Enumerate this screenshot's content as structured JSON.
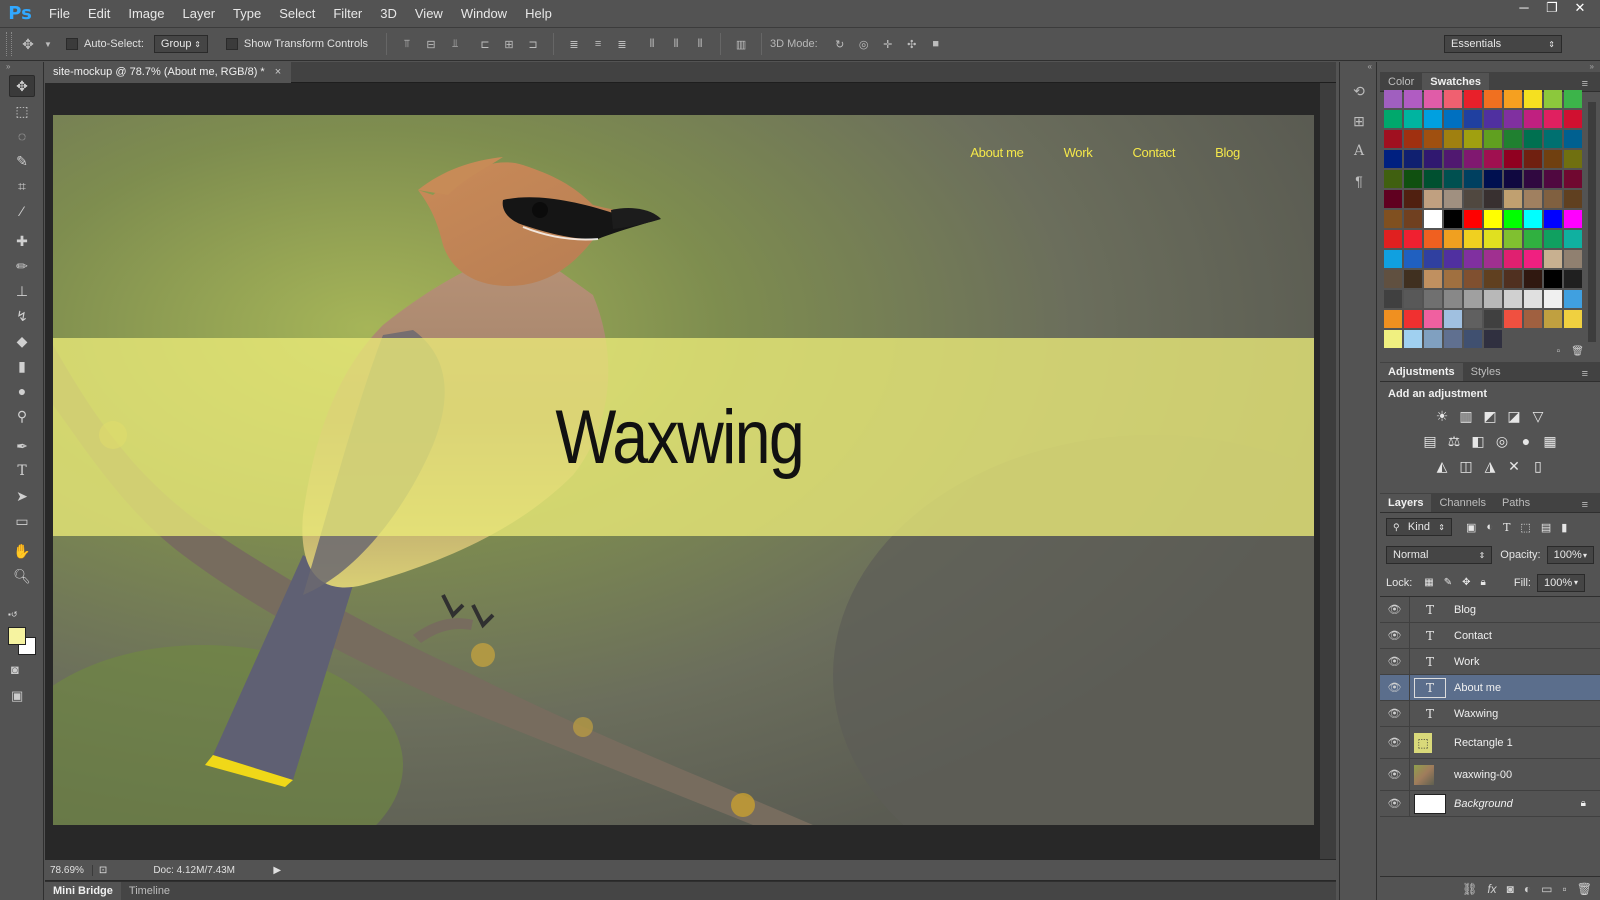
{
  "app": {
    "logo": "Ps",
    "menu": [
      "File",
      "Edit",
      "Image",
      "Layer",
      "Type",
      "Select",
      "Filter",
      "3D",
      "View",
      "Window",
      "Help"
    ]
  },
  "window_controls": [
    "─",
    "❐",
    "✕"
  ],
  "options_bar": {
    "auto_select_label": "Auto-Select:",
    "auto_select_value": "Group",
    "show_transform_label": "Show Transform Controls",
    "mode_label": "3D Mode:",
    "workspace": "Essentials"
  },
  "document": {
    "tab_title": "site-mockup @ 78.7% (About me, RGB/8) *",
    "close_glyph": "×",
    "zoom": "78.69%",
    "doc_info": "Doc: 4.12M/7.43M"
  },
  "canvas": {
    "nav": [
      "About me",
      "Work",
      "Contact",
      "Blog"
    ],
    "title": "Waxwing",
    "nav_color": "#f5e84a",
    "band_color": "#ebeb78"
  },
  "bottom_tabs": [
    "Mini Bridge",
    "Timeline"
  ],
  "swatches_panel": {
    "tabs": [
      "Color",
      "Swatches"
    ],
    "active": "Swatches",
    "colors": [
      "#a05fbf",
      "#b05cc2",
      "#e05ca8",
      "#f06070",
      "#e8202a",
      "#f07020",
      "#f5a020",
      "#f5e020",
      "#8cc83c",
      "#3cb44a",
      "#00a86c",
      "#00b4a0",
      "#00a0e0",
      "#0070c0",
      "#2040a0",
      "#5030a0",
      "#8030a0",
      "#c02080",
      "#e02060",
      "#d01030",
      "#a01020",
      "#a03010",
      "#a05010",
      "#a08010",
      "#a0a010",
      "#60a020",
      "#208030",
      "#007050",
      "#007070",
      "#006090",
      "#002080",
      "#102070",
      "#301870",
      "#501870",
      "#801870",
      "#a01050",
      "#900020",
      "#702010",
      "#704010",
      "#707010",
      "#406010",
      "#105010",
      "#005030",
      "#005050",
      "#004060",
      "#001050",
      "#100840",
      "#300840",
      "#500840",
      "#700830",
      "#600020",
      "#502010",
      "#c0a080",
      "#a09080",
      "#504840",
      "#383030",
      "#c0a070",
      "#a08060",
      "#806040",
      "#604020",
      "#805020",
      "#704020",
      "#ffffff",
      "#000000",
      "#ff0000",
      "#ffff00",
      "#00ff00",
      "#00ffff",
      "#0000ff",
      "#ff00ff",
      "#e02020",
      "#f02030",
      "#f06020",
      "#f0a020",
      "#f0d020",
      "#e0e020",
      "#80c030",
      "#30b040",
      "#10a060",
      "#10b0a0",
      "#10a0e0",
      "#2060c0",
      "#3040a0",
      "#5030a0",
      "#8030a0",
      "#a03090",
      "#e02070",
      "#f02080",
      "#c8b090",
      "#908070",
      "#605040",
      "#403020",
      "#c09060",
      "#a07040",
      "#805030",
      "#604020",
      "#503020",
      "#301810",
      "#000000",
      "#202020",
      "#404040",
      "#585858",
      "#707070",
      "#888888",
      "#a0a0a0",
      "#b8b8b8",
      "#d0d0d0",
      "#e0e0e0",
      "#f0f0f0",
      "#40a0e0",
      "#f09020",
      "#f03030",
      "#f060a0",
      "#a0c0e0",
      "#606060",
      "#404040",
      "#f05040",
      "#a06040",
      "#c0a040",
      "#f0d040",
      "#f0f080",
      "#a0d0f0",
      "#80a0c0",
      "#607090",
      "#405070",
      "#303040"
    ]
  },
  "adjustments_panel": {
    "tabs": [
      "Adjustments",
      "Styles"
    ],
    "active": "Adjustments",
    "heading": "Add an adjustment",
    "icon_rows": [
      [
        "☀",
        "▥",
        "◩",
        "◪",
        "▽"
      ],
      [
        "▤",
        "⚖",
        "◧",
        "◎",
        "●",
        "▦"
      ],
      [
        "◭",
        "◫",
        "◮",
        "✕",
        "▯"
      ]
    ]
  },
  "layers_panel": {
    "tabs": [
      "Layers",
      "Channels",
      "Paths"
    ],
    "active": "Layers",
    "filter_kind": "Kind",
    "blend_mode": "Normal",
    "opacity_label": "Opacity:",
    "opacity": "100%",
    "lock_label": "Lock:",
    "fill_label": "Fill:",
    "fill": "100%",
    "layers": [
      {
        "name": "Blog",
        "kind": "text",
        "selected": false
      },
      {
        "name": "Contact",
        "kind": "text",
        "selected": false
      },
      {
        "name": "Work",
        "kind": "text",
        "selected": false
      },
      {
        "name": "About me",
        "kind": "text",
        "selected": true
      },
      {
        "name": "Waxwing",
        "kind": "text",
        "selected": false
      },
      {
        "name": "Rectangle 1",
        "kind": "shape",
        "selected": false
      },
      {
        "name": "waxwing-00",
        "kind": "image",
        "selected": false
      },
      {
        "name": "Background",
        "kind": "background",
        "selected": false
      }
    ]
  }
}
